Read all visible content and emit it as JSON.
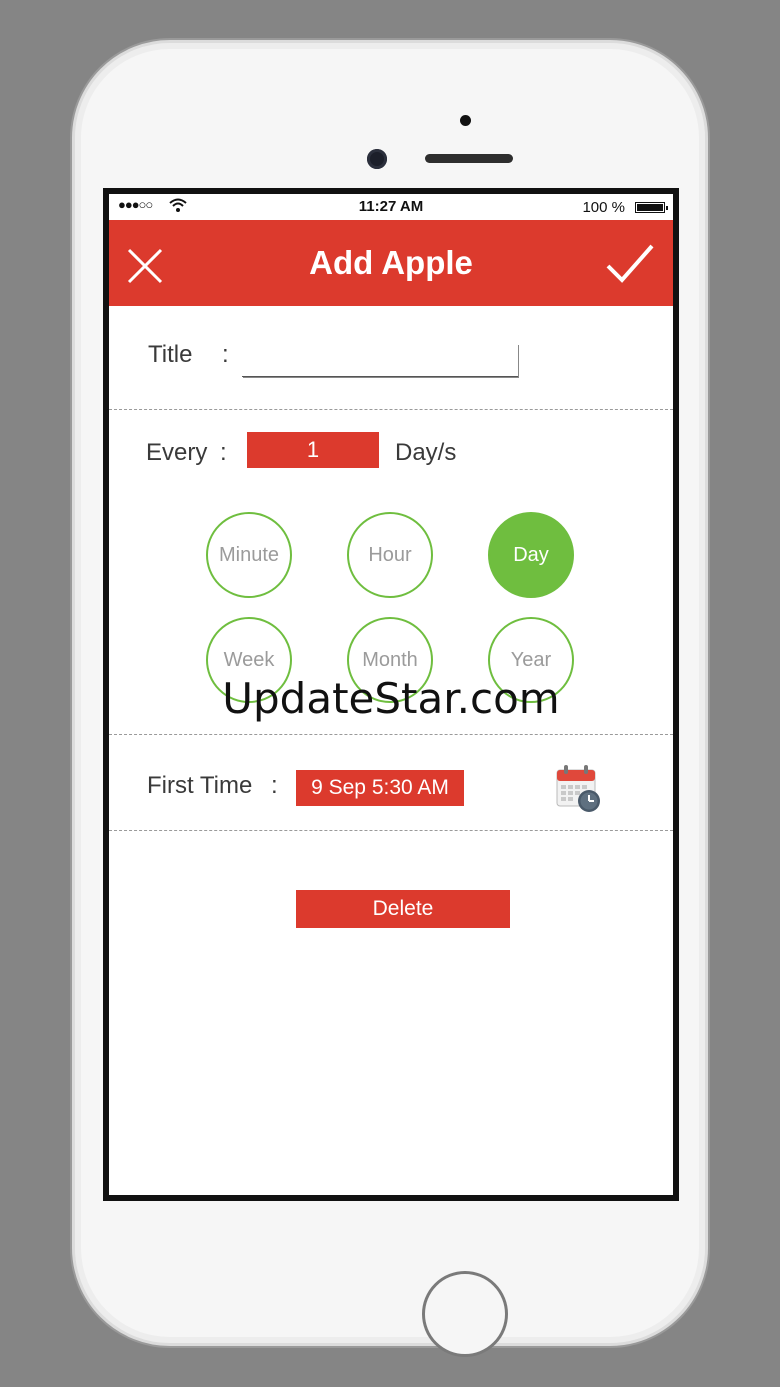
{
  "status_bar": {
    "signal": "●●●○○",
    "time": "11:27 AM",
    "battery": "100 %"
  },
  "appbar": {
    "title": "Add Apple",
    "close_icon": "close-icon",
    "confirm_icon": "checkmark-icon"
  },
  "form": {
    "title_label": "Title",
    "title_colon": ":",
    "title_value": "",
    "every_label": "Every",
    "every_colon": ":",
    "every_value": "1",
    "every_unit": "Day/s",
    "intervals": [
      {
        "label": "Minute",
        "selected": false
      },
      {
        "label": "Hour",
        "selected": false
      },
      {
        "label": "Day",
        "selected": true
      },
      {
        "label": "Week",
        "selected": false
      },
      {
        "label": "Month",
        "selected": false
      },
      {
        "label": "Year",
        "selected": false
      }
    ],
    "first_time_label": "First Time",
    "first_time_colon": ":",
    "first_time_value": "9 Sep 5:30 AM",
    "calendar_icon": "calendar-clock-icon",
    "delete_label": "Delete"
  },
  "watermark": "UpdateStar.com",
  "colors": {
    "accent_red": "#dc3a2d",
    "accent_green": "#6fbe3f"
  }
}
